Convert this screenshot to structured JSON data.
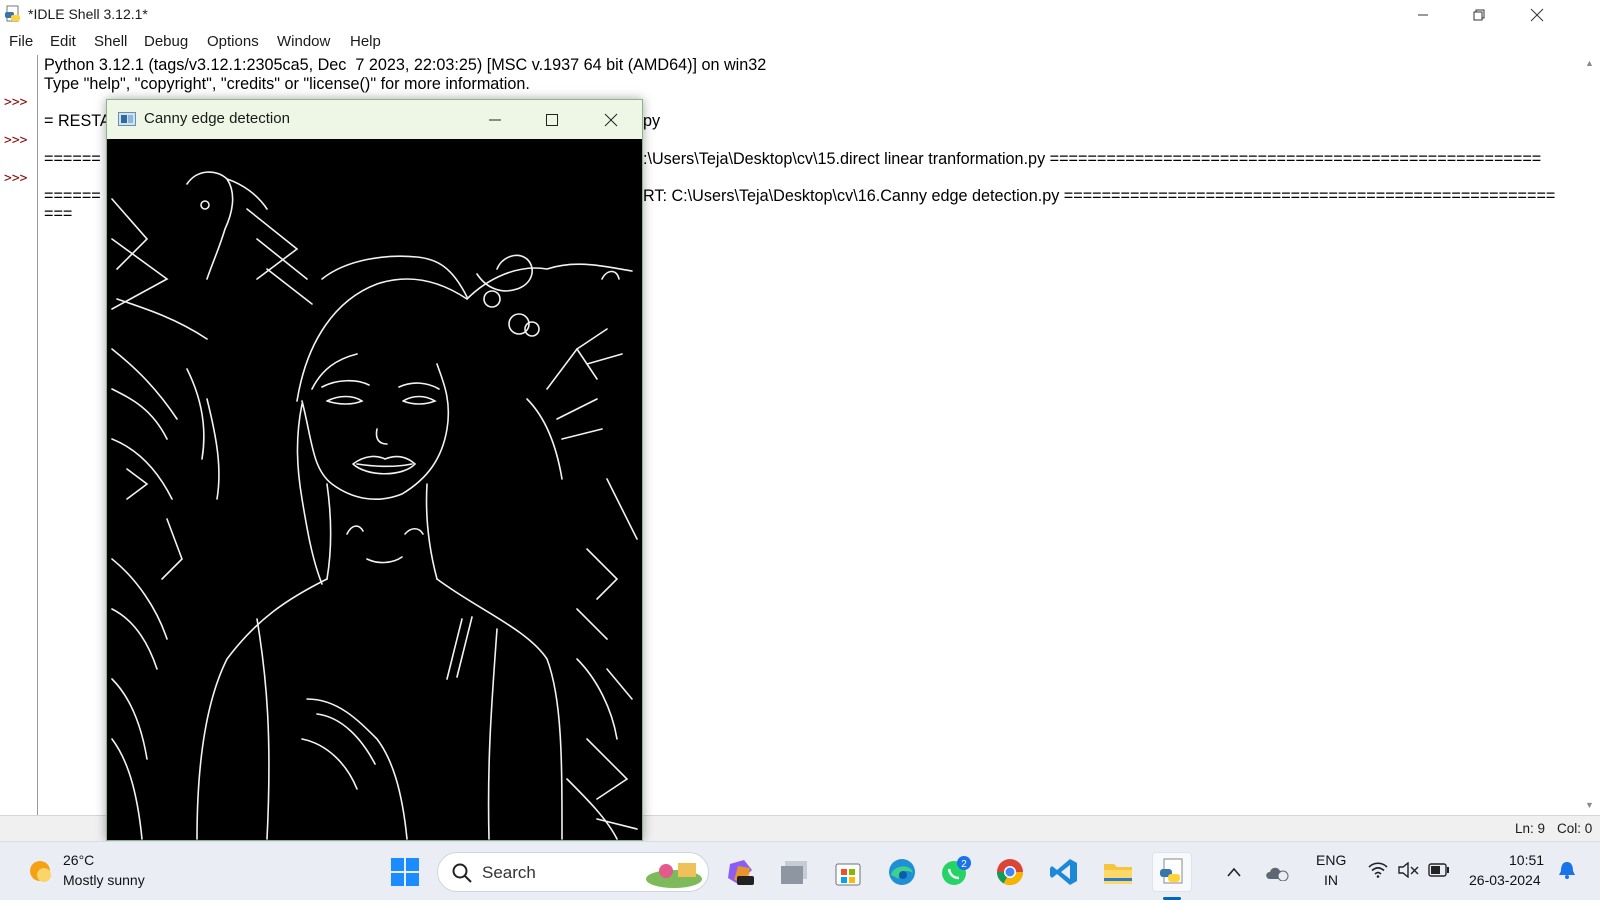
{
  "window": {
    "title": "*IDLE Shell 3.12.1*",
    "minimize_icon": "minimize-icon",
    "restore_icon": "restore-icon",
    "close_icon": "close-icon"
  },
  "menu": {
    "items": [
      "File",
      "Edit",
      "Shell",
      "Debug",
      "Options",
      "Window",
      "Help"
    ]
  },
  "shell": {
    "prompt": ">>>",
    "lines": [
      "Python 3.12.1 (tags/v3.12.1:2305ca5, Dec  7 2023, 22:03:25) [MSC v.1937 64 bit (AMD64)] on win32",
      "Type \"help\", \"copyright\", \"credits\" or \"license()\" for more information.",
      "= RESTA",
      "py",
      "======",
      ":\\Users\\Teja\\Desktop\\cv\\15.direct linear tranformation.py ====================================================",
      "======",
      "RT: C:\\Users\\Teja\\Desktop\\cv\\16.Canny edge detection.py ====================================================",
      "==="
    ]
  },
  "status": {
    "line": "Ln: 9",
    "col": "Col: 0"
  },
  "canny": {
    "title": "Canny edge detection",
    "image_desc": "Canny edge map of a woman with flowers, a bird and leaves"
  },
  "taskbar": {
    "weather_temp": "26°C",
    "weather_desc": "Mostly sunny",
    "search_label": "Search",
    "whatsapp_badge": "2",
    "lang_top": "ENG",
    "lang_bottom": "IN",
    "time": "10:51",
    "date": "26-03-2024"
  },
  "colors": {
    "prompt": "#8a0a0a",
    "canny_titlebar": "#eef7e6",
    "taskbar": "#eaeef4",
    "accent": "#0067c0"
  }
}
